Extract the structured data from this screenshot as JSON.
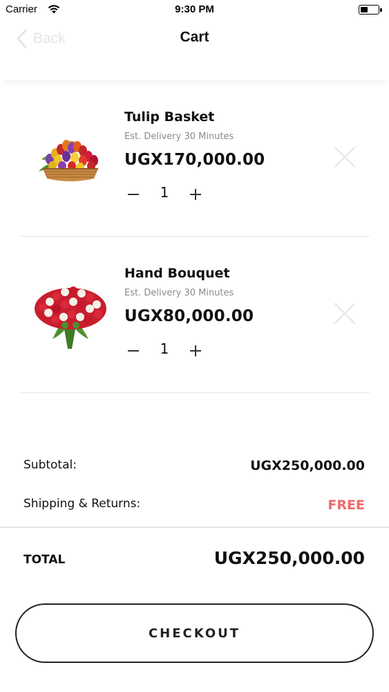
{
  "status_bar": {
    "carrier": "Carrier",
    "time": "9:30 PM",
    "icons": [
      "wifi-icon",
      "battery-icon"
    ]
  },
  "nav": {
    "back_label": "Back",
    "title": "Cart"
  },
  "cart": {
    "items": [
      {
        "name": "Tulip Basket",
        "delivery": "Est. Delivery 30 Minutes",
        "price": "UGX170,000.00",
        "quantity": "1",
        "image": "tulip-basket-image"
      },
      {
        "name": "Hand Bouquet",
        "delivery": "Est. Delivery 30 Minutes",
        "price": "UGX80,000.00",
        "quantity": "1",
        "image": "rose-bouquet-image"
      }
    ]
  },
  "summary": {
    "subtotal_label": "Subtotal:",
    "subtotal_value": "UGX250,000.00",
    "shipping_label": "Shipping & Returns:",
    "shipping_value": "FREE",
    "total_label": "TOTAL",
    "total_value": "UGX250,000.00"
  },
  "checkout": {
    "label": "CHECKOUT"
  },
  "colors": {
    "free_accent": "#ee6a6a",
    "text_primary": "#111111",
    "text_muted": "#8a8a8a",
    "divider": "#e6e6e6"
  }
}
